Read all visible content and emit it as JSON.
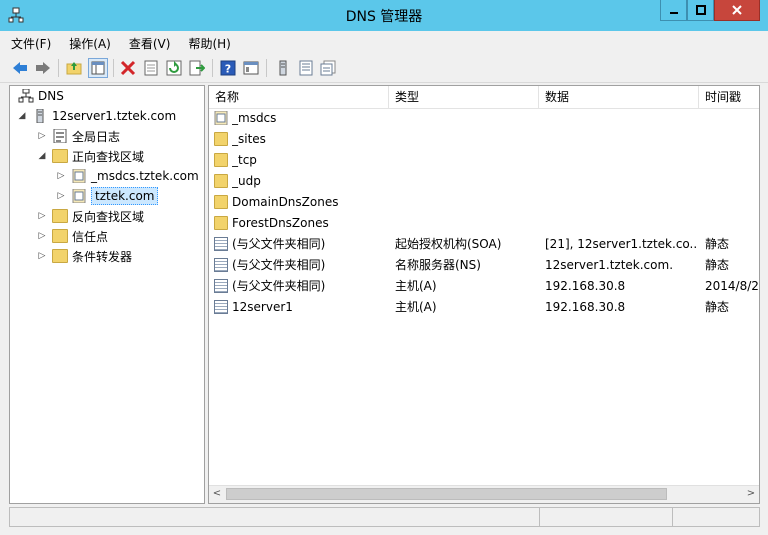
{
  "window": {
    "title": "DNS 管理器"
  },
  "menu": [
    "文件(F)",
    "操作(A)",
    "查看(V)",
    "帮助(H)"
  ],
  "tree": {
    "root": "DNS",
    "server": "12server1.tztek.com",
    "items": [
      {
        "label": "全局日志"
      },
      {
        "label": "正向查找区域"
      },
      {
        "label": "_msdcs.tztek.com"
      },
      {
        "label": "tztek.com"
      },
      {
        "label": "反向查找区域"
      },
      {
        "label": "信任点"
      },
      {
        "label": "条件转发器"
      }
    ]
  },
  "columns": [
    "名称",
    "类型",
    "数据",
    "时间戳"
  ],
  "rows": [
    {
      "name": "_msdcs",
      "type": "",
      "data": "",
      "timestamp": ""
    },
    {
      "name": "_sites",
      "type": "",
      "data": "",
      "timestamp": ""
    },
    {
      "name": "_tcp",
      "type": "",
      "data": "",
      "timestamp": ""
    },
    {
      "name": "_udp",
      "type": "",
      "data": "",
      "timestamp": ""
    },
    {
      "name": "DomainDnsZones",
      "type": "",
      "data": "",
      "timestamp": ""
    },
    {
      "name": "ForestDnsZones",
      "type": "",
      "data": "",
      "timestamp": ""
    },
    {
      "name": "(与父文件夹相同)",
      "type": "起始授权机构(SOA)",
      "data": "[21], 12server1.tztek.co...",
      "timestamp": "静态"
    },
    {
      "name": "(与父文件夹相同)",
      "type": "名称服务器(NS)",
      "data": "12server1.tztek.com.",
      "timestamp": "静态"
    },
    {
      "name": "(与父文件夹相同)",
      "type": "主机(A)",
      "data": "192.168.30.8",
      "timestamp": "2014/8/2"
    },
    {
      "name": "12server1",
      "type": "主机(A)",
      "data": "192.168.30.8",
      "timestamp": "静态"
    }
  ],
  "icons": {
    "toolbar": [
      "back-arrow-icon",
      "forward-arrow-icon",
      "up-folder-icon",
      "show-hide-tree-icon",
      "delete-icon",
      "properties-icon",
      "refresh-icon",
      "export-icon",
      "help-icon",
      "console-icon",
      "server-icon",
      "record-icon",
      "records-icon"
    ]
  }
}
